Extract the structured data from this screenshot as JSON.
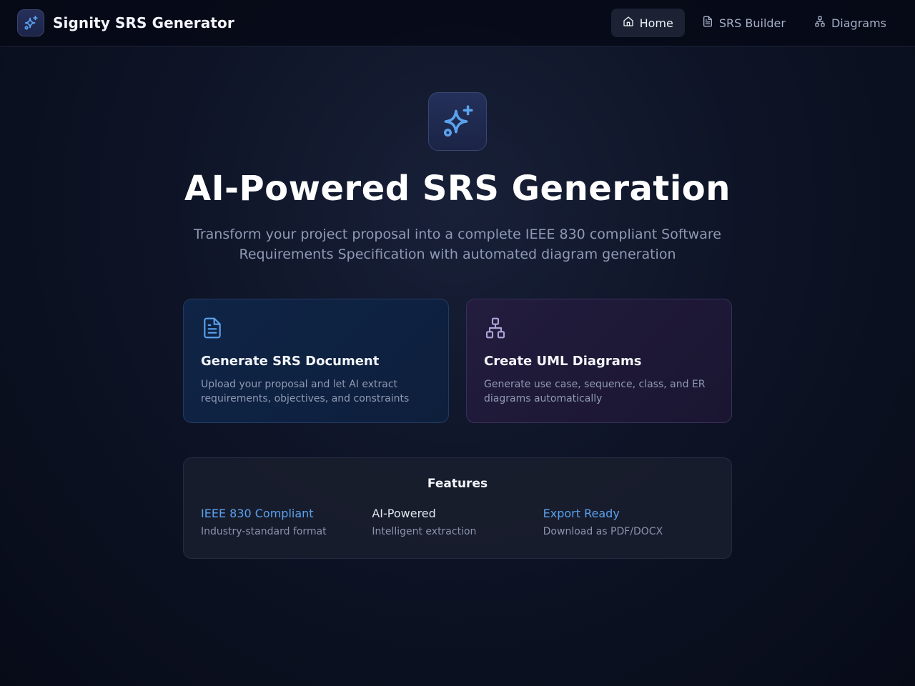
{
  "app": {
    "title": "Signity SRS Generator",
    "logo_icon": "sparkles-icon"
  },
  "nav": {
    "items": [
      {
        "label": "Home",
        "icon": "home-icon",
        "active": true
      },
      {
        "label": "SRS Builder",
        "icon": "document-icon",
        "active": false
      },
      {
        "label": "Diagrams",
        "icon": "sitemap-icon",
        "active": false
      }
    ]
  },
  "hero": {
    "icon": "sparkles-icon",
    "title": "AI-Powered SRS Generation",
    "subtitle": "Transform your project proposal into a complete IEEE 830 compliant Software Requirements Specification with automated diagram generation"
  },
  "cards": [
    {
      "icon": "document-icon",
      "title": "Generate SRS Document",
      "description": "Upload your proposal and let AI extract requirements, objectives, and constraints"
    },
    {
      "icon": "sitemap-icon",
      "title": "Create UML Diagrams",
      "description": "Generate use case, sequence, class, and ER diagrams automatically"
    }
  ],
  "features": {
    "title": "Features",
    "items": [
      {
        "name": "IEEE 830 Compliant",
        "description": "Industry-standard format"
      },
      {
        "name": "AI-Powered",
        "description": "Intelligent extraction"
      },
      {
        "name": "Export Ready",
        "description": "Download as PDF/DOCX"
      }
    ]
  },
  "colors": {
    "accent_blue": "#5aa2ee",
    "accent_purple": "#a9a4d6",
    "background": "#0b1022"
  }
}
